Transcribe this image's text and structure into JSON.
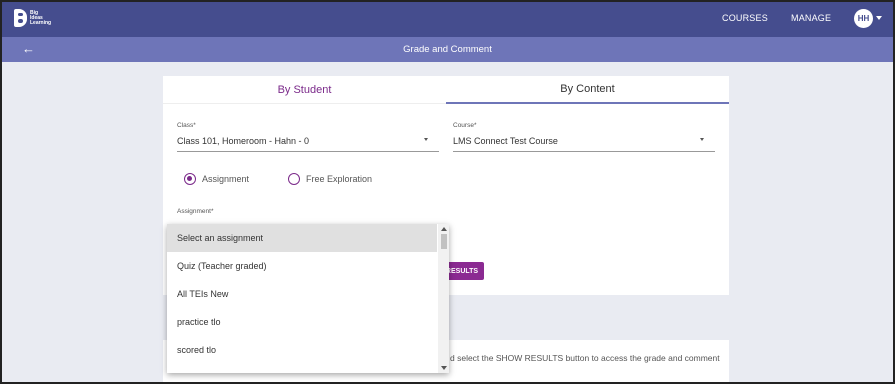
{
  "brand": {
    "logo_text": "Big Ideas Learning"
  },
  "nav": {
    "courses": "COURSES",
    "manage": "MANAGE",
    "avatar_initials": "HH"
  },
  "subheader": {
    "back_icon": "arrow-left-icon",
    "title": "Grade and Comment"
  },
  "tabs": [
    {
      "label": "By Student",
      "active": false
    },
    {
      "label": "By Content",
      "active": true
    }
  ],
  "filters": {
    "class_label": "Class*",
    "class_value": "Class 101, Homeroom - Hahn - 0",
    "course_label": "Course*",
    "course_value": "LMS Connect Test Course",
    "assignment_label": "Assignment*"
  },
  "mode": {
    "options": [
      "Assignment",
      "Free Exploration"
    ],
    "selected": "Assignment"
  },
  "results_button_visible": "RESULTS",
  "info_text": "d select the SHOW RESULTS button to access the grade and comment",
  "dropdown": {
    "items": [
      "Select an assignment",
      "Quiz (Teacher graded)",
      "All TEIs New",
      "practice tlo",
      "scored tlo"
    ],
    "selected_index": 0
  },
  "colors": {
    "navbar": "#454d8e",
    "subbar": "#6e75b8",
    "accent": "#7b2a8a",
    "button": "#8b2a92"
  }
}
